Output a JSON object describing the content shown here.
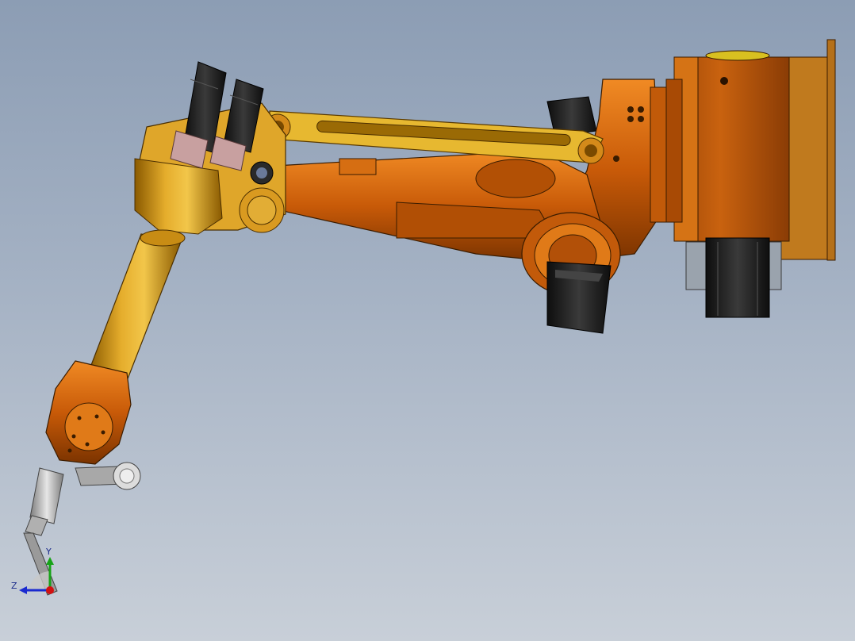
{
  "viewport": {
    "background_top": "#8c9db4",
    "background_bottom": "#c8cfd8"
  },
  "model": {
    "component": "robot-arm",
    "colors": {
      "orange": "#d4650f",
      "gold": "#d79a17",
      "motor": "#1b1b1b",
      "metal": "#c9c9c9"
    }
  },
  "triad": {
    "y_label": "Y",
    "z_label": "Z",
    "x_color": "#d21010",
    "y_color": "#17a317",
    "z_color": "#1a2ad0"
  }
}
